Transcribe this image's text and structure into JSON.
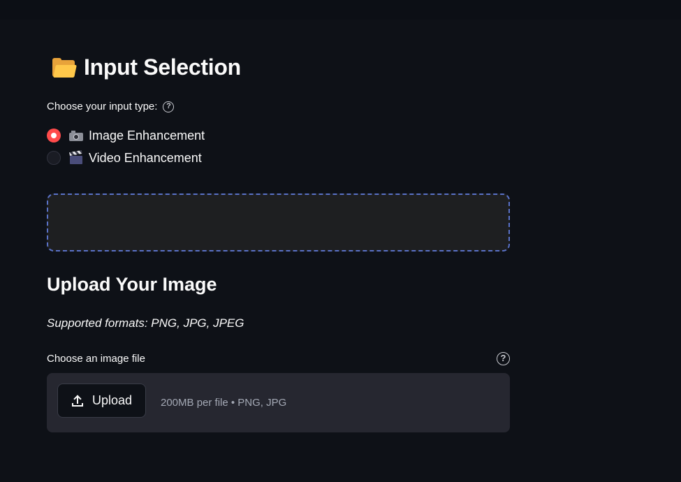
{
  "header": {
    "title": "Input Selection",
    "icon": "folder-icon"
  },
  "input_type": {
    "label": "Choose your input type:",
    "options": [
      {
        "label": "Image Enhancement",
        "icon": "camera-icon",
        "selected": true
      },
      {
        "label": "Video Enhancement",
        "icon": "clapper-board-icon",
        "selected": false
      }
    ]
  },
  "upload_section": {
    "title": "Upload Your Image",
    "formats_note": "Supported formats: PNG, JPG, JPEG",
    "file_label": "Choose an image file",
    "button_label": "Upload",
    "limit_text": "200MB per file • PNG, JPG"
  },
  "colors": {
    "background": "#0e1117",
    "accent": "#ff4b4b",
    "dashed_border": "#5a72c8",
    "dropzone": "#262730"
  }
}
